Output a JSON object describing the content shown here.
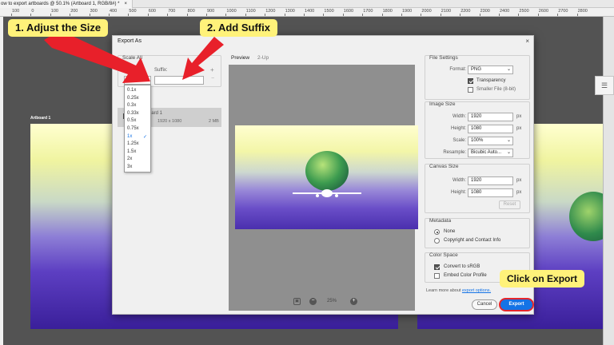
{
  "document_tab": {
    "title": "ow to export artboards @ 50.1% (Artboard 1, RGB/8#) *",
    "close": "×"
  },
  "ruler_labels": [
    "100",
    "0",
    "100",
    "200",
    "300",
    "400",
    "500",
    "600",
    "700",
    "800",
    "900",
    "1000",
    "1100",
    "1200",
    "1300",
    "1400",
    "1500",
    "1600",
    "1700",
    "1800",
    "1900",
    "2000",
    "2100",
    "2200",
    "2300",
    "2400",
    "2500",
    "2600",
    "2700",
    "2800"
  ],
  "artboard_label": "Artboard 1",
  "dialog": {
    "title": "Export As",
    "close": "×",
    "scale_all": {
      "heading": "Scale All",
      "size_label": "Size:",
      "suffix_label": "Suffix:",
      "size_value": "1x",
      "suffix_value": "",
      "add": "+",
      "remove": "−"
    },
    "size_options": [
      "0.1x",
      "0.25x",
      "0.3x",
      "0.33x",
      "0.5x",
      "0.75x",
      "1x",
      "1.25x",
      "1.5x",
      "2x",
      "3x"
    ],
    "asset": {
      "name": "rtboard 1",
      "format": "NG",
      "dimensions": "1920 x 1080",
      "filesize": "2 MB"
    },
    "preview_tabs": [
      "Preview",
      "2-Up"
    ],
    "zoom": "25%",
    "file_settings": {
      "heading": "File Settings",
      "format_label": "Format:",
      "format_value": "PNG",
      "transparency": "Transparency",
      "smaller_file": "Smaller File (8-bit)"
    },
    "image_size": {
      "heading": "Image Size",
      "width_label": "Width:",
      "width_value": "1920",
      "height_label": "Height:",
      "height_value": "1080",
      "scale_label": "Scale:",
      "scale_value": "100%",
      "resample_label": "Resample:",
      "resample_value": "Bicubic Auto...",
      "unit": "px"
    },
    "canvas_size": {
      "heading": "Canvas Size",
      "width_label": "Width:",
      "width_value": "1920",
      "height_label": "Height:",
      "height_value": "1080",
      "unit": "px",
      "reset": "Reset"
    },
    "metadata": {
      "heading": "Metadata",
      "none": "None",
      "copyright": "Copyright and Contact Info"
    },
    "color_space": {
      "heading": "Color Space",
      "convert": "Convert to sRGB",
      "embed": "Embed Color Profile"
    },
    "learn_more": "Learn more about",
    "export_options": "export options.",
    "cancel": "Cancel",
    "export": "Export"
  },
  "callouts": {
    "step1": "1. Adjust the Size",
    "step2": "2. Add Suffix",
    "step3": "Click on Export"
  }
}
